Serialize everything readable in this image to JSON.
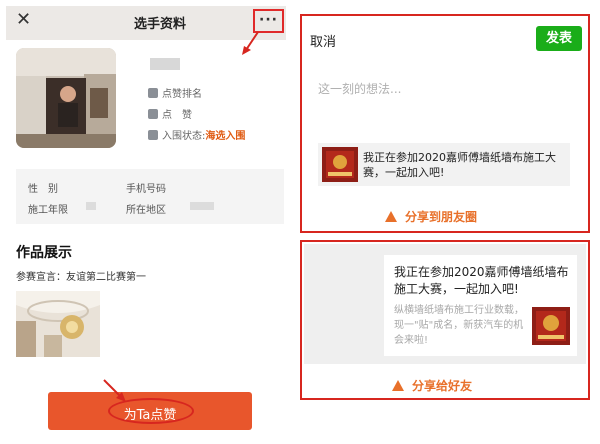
{
  "profile_page": {
    "title": "选手资料",
    "status_label": "入围状态:",
    "status_value": "海选入围",
    "fields": [
      {
        "label": "性　别",
        "value": ""
      },
      {
        "label": "手机号码",
        "value": ""
      },
      {
        "label": "施工年限",
        "value": ""
      },
      {
        "label": "所在地区",
        "value": ""
      }
    ],
    "points_label": "点赞排名",
    "likes_label": "点　赞",
    "section_title": "作品展示",
    "declaration": "参赛宣言：友谊第二比赛第一",
    "like_button_label": "为Ta点赞"
  },
  "moments_share": {
    "cancel_label": "取消",
    "publish_label": "发表",
    "input_placeholder": "这一刻的想法...",
    "link_text": "我正在参加2020嘉师傅墙纸墙布施工大赛，一起加入吧!",
    "caption": "分享到朋友圈"
  },
  "friend_share": {
    "title": "我正在参加2020嘉师傅墙纸墙布施工大赛，一起加入吧!",
    "description": "纵横墙纸墙布施工行业数载，现一\"贴\"成名，新获汽车的机会来啦!",
    "caption": "分享给好友"
  },
  "colors": {
    "highlight_red": "#d7261f",
    "like_button": "#e8562c",
    "publish_green": "#1aad19",
    "caption_orange": "#e8702a"
  }
}
